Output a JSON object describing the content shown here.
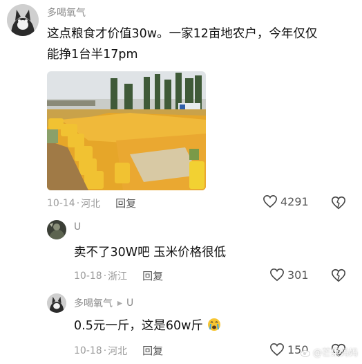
{
  "comments": [
    {
      "username": "多喝氧气",
      "text": "这点粮食才价值30w。一家12亩地农户，今年仅仅能挣1台半17pm",
      "date": "10-14",
      "location": "河北",
      "reply_label": "回复",
      "likes": "4291",
      "avatar": "cat-avatar",
      "image": "corn-harvest-photo"
    },
    {
      "username": "U",
      "text": "卖不了30W吧 玉米价格很低",
      "date": "10-18",
      "location": "浙江",
      "reply_label": "回复",
      "likes": "301",
      "avatar": "dark-avatar"
    },
    {
      "username": "多喝氧气",
      "reply_to": "U",
      "text": "0.5元一斤，这是60w斤",
      "date": "10-18",
      "location": "河北",
      "reply_label": "回复",
      "likes": "150",
      "avatar": "cat-avatar",
      "emoji": "crying-face"
    }
  ],
  "separator": "·",
  "watermark": "@芒果妈妈",
  "icons": {
    "like": "heart-outline-icon",
    "dislike": "broken-heart-icon",
    "reply_arrow": "triangle-right-icon"
  }
}
